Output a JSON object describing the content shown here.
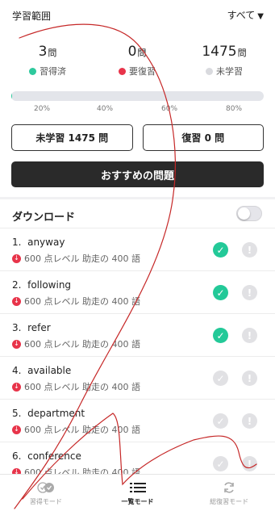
{
  "header": {
    "title": "学習範囲",
    "filter_label": "すべて",
    "filter_caret": "▼"
  },
  "stats": [
    {
      "value": "3",
      "unit": "問",
      "label": "習得済",
      "color": "#2ec99d"
    },
    {
      "value": "0",
      "unit": "問",
      "label": "要復習",
      "color": "#e8344a"
    },
    {
      "value": "1475",
      "unit": "問",
      "label": "未学習",
      "color": "#d9dade"
    }
  ],
  "progress": {
    "learned_fraction": 0.002,
    "ticks": [
      "20%",
      "40%",
      "60%",
      "80%"
    ]
  },
  "buttons": {
    "unlearned": "未学習 1475 問",
    "review": "復習 0 問",
    "recommended": "おすすめの問題"
  },
  "download": {
    "label": "ダウンロード",
    "enabled": false
  },
  "words": [
    {
      "index": "1.",
      "word": "anyway",
      "meta": "600 点レベル 助走の 400 語",
      "learned": true
    },
    {
      "index": "2.",
      "word": "following",
      "meta": "600 点レベル 助走の 400 語",
      "learned": true
    },
    {
      "index": "3.",
      "word": "refer",
      "meta": "600 点レベル 助走の 400 語",
      "learned": true
    },
    {
      "index": "4.",
      "word": "available",
      "meta": "600 点レベル 助走の 400 語",
      "learned": false
    },
    {
      "index": "5.",
      "word": "department",
      "meta": "600 点レベル 助走の 400 語",
      "learned": false
    },
    {
      "index": "6.",
      "word": "conference",
      "meta": "600 点レベル 助走の 400 語",
      "learned": false
    }
  ],
  "tabs": {
    "study": {
      "label": "習得モード",
      "icon": "double-check-icon"
    },
    "list": {
      "label": "一覧モード",
      "icon": "list-icon"
    },
    "review": {
      "label": "総復習モード",
      "icon": "refresh-icon"
    }
  },
  "colors": {
    "accent_green": "#23c998",
    "alert_red": "#e8344a",
    "dark_button": "#2a2a2a"
  }
}
